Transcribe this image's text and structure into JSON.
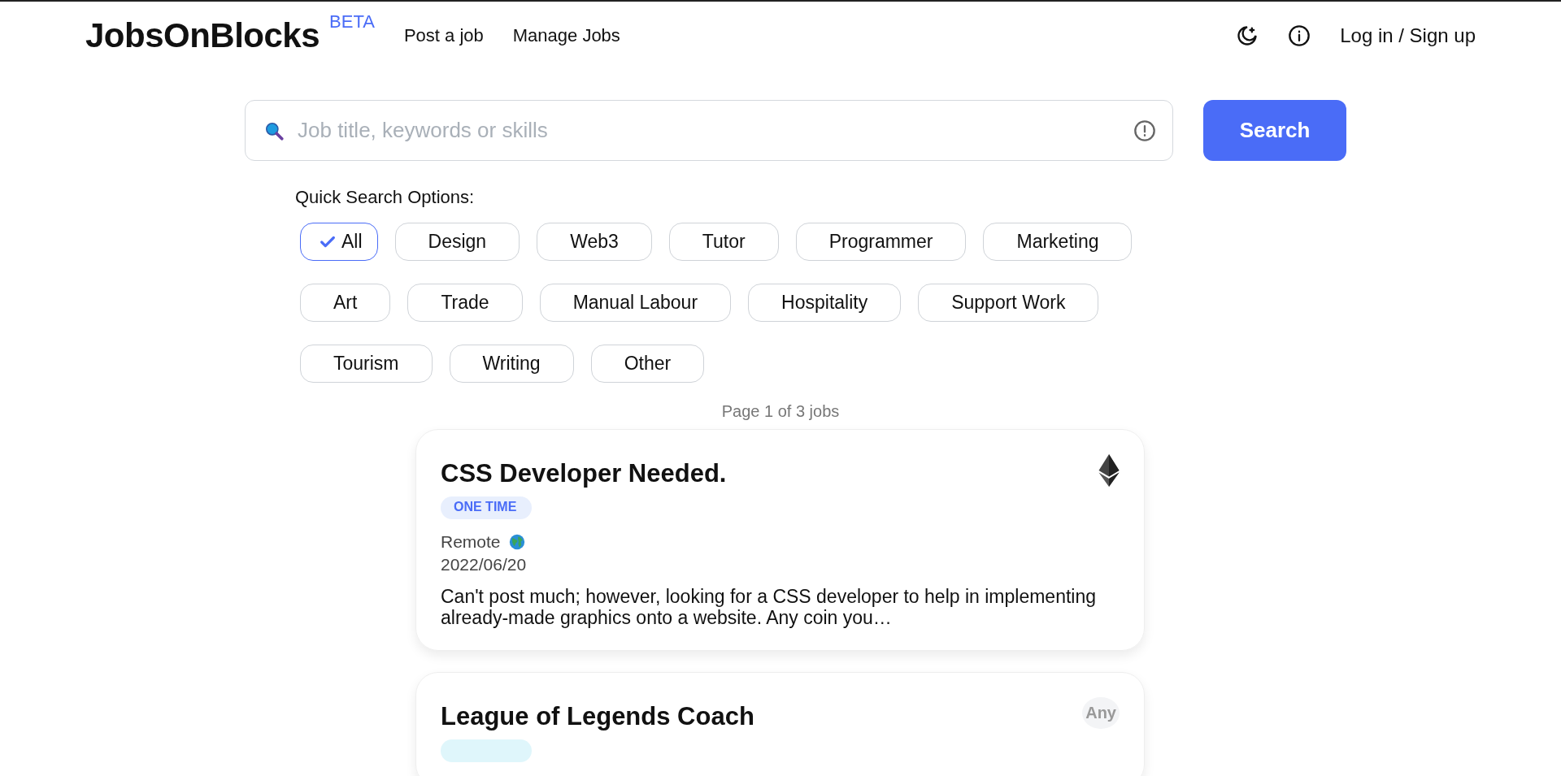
{
  "header": {
    "logo": "JobsOnBlocks",
    "badge": "BETA",
    "nav": [
      {
        "label": "Post a job"
      },
      {
        "label": "Manage Jobs"
      }
    ],
    "auth_link": "Log in / Sign up"
  },
  "search": {
    "placeholder": "Job title, keywords or skills",
    "button": "Search"
  },
  "quick_search": {
    "label": "Quick Search Options:",
    "options": [
      {
        "label": "All",
        "selected": true
      },
      {
        "label": "Design",
        "selected": false
      },
      {
        "label": "Web3",
        "selected": false
      },
      {
        "label": "Tutor",
        "selected": false
      },
      {
        "label": "Programmer",
        "selected": false
      },
      {
        "label": "Marketing",
        "selected": false
      },
      {
        "label": "Art",
        "selected": false
      },
      {
        "label": "Trade",
        "selected": false
      },
      {
        "label": "Manual Labour",
        "selected": false
      },
      {
        "label": "Hospitality",
        "selected": false
      },
      {
        "label": "Support Work",
        "selected": false
      },
      {
        "label": "Tourism",
        "selected": false
      },
      {
        "label": "Writing",
        "selected": false
      },
      {
        "label": "Other",
        "selected": false
      }
    ]
  },
  "page_info": "Page 1 of 3 jobs",
  "jobs": [
    {
      "title": "CSS Developer Needed.",
      "tag": {
        "kind": "one_time",
        "label": "ONE TIME"
      },
      "payment": {
        "kind": "eth"
      },
      "location": "Remote",
      "date": "2022/06/20",
      "description": "Can't post much; however, looking for a CSS developer to help in implementing already-made graphics onto a website. Any coin you…"
    },
    {
      "title": "League of Legends Coach",
      "tag": {
        "kind": "part_time"
      },
      "payment": {
        "kind": "text",
        "label": "Any"
      }
    }
  ]
}
